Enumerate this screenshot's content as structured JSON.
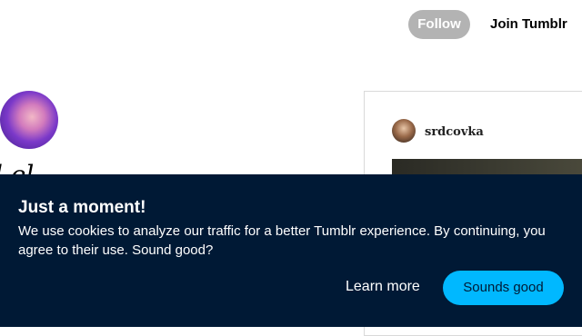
{
  "header": {
    "follow_label": "Follow",
    "join_label": "Join Tumblr"
  },
  "blog": {
    "name_partial": "l  el"
  },
  "post": {
    "username": "srdcovka"
  },
  "cookie_banner": {
    "title": "Just a moment!",
    "message": "We use cookies to analyze our traffic for a better Tumblr experience. By continuing, you agree to their use. Sound good?",
    "learn_more_label": "Learn more",
    "accept_label": "Sounds good"
  },
  "colors": {
    "banner_bg": "#001935",
    "accent": "#00b8ff",
    "follow_bg": "#b3b3b3"
  }
}
